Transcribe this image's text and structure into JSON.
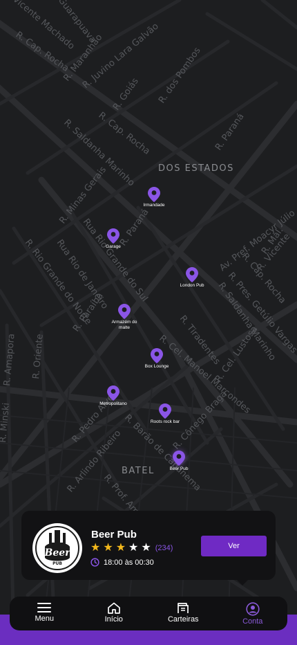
{
  "map": {
    "districts": [
      "DOS ESTADOS",
      "BATEL"
    ],
    "streets": [
      "Vicente Machado",
      "Guarapuava",
      "R. Cap. Rocha",
      "R. Maranhão",
      "R. Juvino Lara Galvão",
      "R. Goiás",
      "R. dos Pombos",
      "R. Paraná",
      "R. Cap. Rocha",
      "R. Saldanha Marinho",
      "R. Minas Gerais",
      "Rua Rio Grande do Sul",
      "R. Paraná",
      "R. Rio Grande do Norte",
      "Rua Rio de Janeiro",
      "R. Paraíba",
      "Av. Pref. Moacyr Júlio",
      "R. Vicente",
      "R. Cap. Rocha",
      "R. Mal.",
      "R. Pres. Getúlio Vargas",
      "R. Saldanha Marinho",
      "R. Tiradentes",
      "R. Cel. Manoel Marcondes",
      "R. Cel. Lustosa",
      "R. Amapora",
      "R. Oriente",
      "R. Minski",
      "R. Pedro Alves",
      "R. Barão de Capanema",
      "R. Cônego Braga",
      "R. Arlindo Ribeiro",
      "R. Prof. Ama"
    ]
  },
  "pins": [
    {
      "label": "Irmandade"
    },
    {
      "label": "Garage"
    },
    {
      "label": "London Pub"
    },
    {
      "label": "Armazém do malte"
    },
    {
      "label": "Box Lounge"
    },
    {
      "label": "Metropolitano"
    },
    {
      "label": "Roots rock bar"
    },
    {
      "label": "Beer Pub"
    }
  ],
  "card": {
    "name": "Beer Pub",
    "logo_text": "Beer",
    "logo_sub": "PUB",
    "rating": 3,
    "rating_max": 5,
    "reviews": "(234)",
    "hours": "18:00 às 00:30",
    "button": "Ver"
  },
  "tabs": [
    {
      "label": "Menu",
      "icon": "menu-icon"
    },
    {
      "label": "Início",
      "icon": "home-icon"
    },
    {
      "label": "Carteiras",
      "icon": "wallet-icon"
    },
    {
      "label": "Conta",
      "icon": "account-icon",
      "active": true
    }
  ],
  "colors": {
    "accent": "#6f2ac4",
    "pin": "#8a55e6",
    "star": "#f3b81c",
    "map_bg": "#1d1e20"
  }
}
